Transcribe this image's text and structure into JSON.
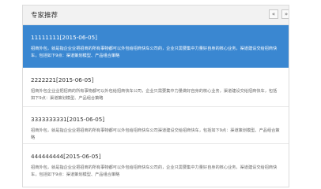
{
  "panel": {
    "title": "专家推荐",
    "prev_label": "«",
    "next_label": "»"
  },
  "experts": [
    {
      "title": "11111111[2015-06-05]",
      "desc": "招商外包，就是指企业业把招商的所有事物都可以外包给招商快车公司的，企业只需要集中力量好自身的核心业务，渠道建设交给招商快车，包括如下9点：渠道策划模型、产品组合策略"
    },
    {
      "title": "2222221[2015-06-05]",
      "desc": "招商外包企业业把招商的所有事物都可以外包给招商快车公司，企业只需要集中力量做好自身的核心业务，渠道建设交给招商快车，包括如下9点：渠道策划模型、产品组合策略"
    },
    {
      "title": "3333333331[2015-06-05]",
      "desc": "招商外包，就是指企业业把招商的所有事物都可以外包给招商快车公司渠道建设交给招商快车，包括如下9点：渠道策划模型、产品组合策略"
    },
    {
      "title": "444444444[2015-06-05]",
      "desc": "招商外包，就是指企业业把招商的所有事物都可以外包给招商快车公司的，企业只需要集中力量好自身的核心业务，渠道建设交给招商快车，包括如下9点：渠道策划模型、产品组合策略"
    }
  ],
  "colors": {
    "active_bg": "#3a87d1",
    "header_bg": "#f2f2f2"
  }
}
